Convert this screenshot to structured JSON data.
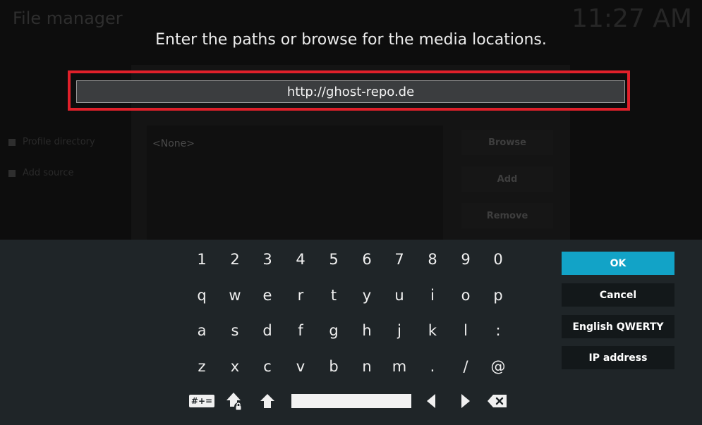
{
  "background": {
    "window_title": "File manager",
    "clock": "11:27 AM",
    "sidebar_items": [
      "Profile directory",
      "Add source"
    ],
    "list_placeholder": "<None>",
    "buttons": [
      "Browse",
      "Add",
      "Remove"
    ]
  },
  "dialog": {
    "heading": "Enter the paths or browse for the media locations.",
    "input_value": "http://ghost-repo.de"
  },
  "keyboard": {
    "rows": [
      [
        "1",
        "2",
        "3",
        "4",
        "5",
        "6",
        "7",
        "8",
        "9",
        "0"
      ],
      [
        "q",
        "w",
        "e",
        "r",
        "t",
        "y",
        "u",
        "i",
        "o",
        "p"
      ],
      [
        "a",
        "s",
        "d",
        "f",
        "g",
        "h",
        "j",
        "k",
        "l",
        ":"
      ],
      [
        "z",
        "x",
        "c",
        "v",
        "b",
        "n",
        "m",
        ".",
        "/",
        "@"
      ]
    ],
    "symbols_label": "#+=",
    "side_buttons": [
      "OK",
      "Cancel",
      "English QWERTY",
      "IP address"
    ],
    "accent_color": "#12a3c7",
    "highlight_color": "#e0202a",
    "icons": [
      "symbols-key",
      "caps-lock-icon",
      "shift-icon",
      "space-bar",
      "left-arrow-icon",
      "right-arrow-icon",
      "backspace-icon"
    ]
  }
}
